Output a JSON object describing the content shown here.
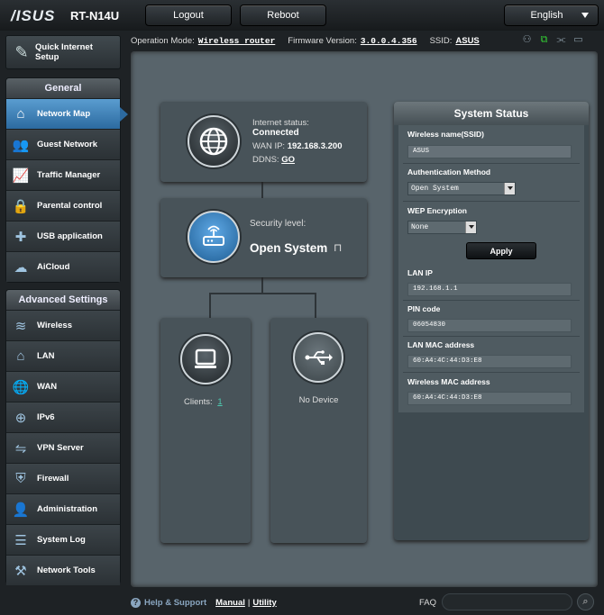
{
  "header": {
    "brand": "/ISUS",
    "model": "RT-N14U",
    "logout_label": "Logout",
    "reboot_label": "Reboot",
    "language": "English"
  },
  "opbar": {
    "op_mode_label": "Operation Mode:",
    "op_mode_value": "Wireless router",
    "firmware_label": "Firmware Version:",
    "firmware_value": "3.0.0.4.356",
    "ssid_label": "SSID:",
    "ssid_value": "ASUS"
  },
  "sidebar": {
    "quick_setup": "Quick Internet Setup",
    "general_title": "General",
    "general_items": [
      {
        "label": "Network Map"
      },
      {
        "label": "Guest Network"
      },
      {
        "label": "Traffic Manager"
      },
      {
        "label": "Parental control"
      },
      {
        "label": "USB application"
      },
      {
        "label": "AiCloud"
      }
    ],
    "advanced_title": "Advanced Settings",
    "advanced_items": [
      {
        "label": "Wireless"
      },
      {
        "label": "LAN"
      },
      {
        "label": "WAN"
      },
      {
        "label": "IPv6"
      },
      {
        "label": "VPN Server"
      },
      {
        "label": "Firewall"
      },
      {
        "label": "Administration"
      },
      {
        "label": "System Log"
      },
      {
        "label": "Network Tools"
      }
    ]
  },
  "map": {
    "internet_status_label": "Internet status:",
    "internet_status_value": "Connected",
    "wan_ip_label": "WAN IP:",
    "wan_ip_value": "192.168.3.200",
    "ddns_label": "DDNS:",
    "ddns_value": "GO",
    "security_label": "Security level:",
    "security_value": "Open System",
    "clients_label": "Clients:",
    "clients_value": "1",
    "usb_label": "No Device"
  },
  "status": {
    "title": "System Status",
    "ssid_label": "Wireless name(SSID)",
    "ssid_value": "ASUS",
    "auth_label": "Authentication Method",
    "auth_value": "Open System",
    "wep_label": "WEP Encryption",
    "wep_value": "None",
    "apply_label": "Apply",
    "lan_ip_label": "LAN IP",
    "lan_ip_value": "192.168.1.1",
    "pin_label": "PIN code",
    "pin_value": "06054830",
    "lan_mac_label": "LAN MAC address",
    "lan_mac_value": "60:A4:4C:44:D3:E8",
    "wl_mac_label": "Wireless MAC address",
    "wl_mac_value": "60:A4:4C:44:D3:E8"
  },
  "footer": {
    "help_label": "Help & Support",
    "manual_label": "Manual",
    "divider": "|",
    "utility_label": "Utility",
    "faq_label": "FAQ"
  }
}
